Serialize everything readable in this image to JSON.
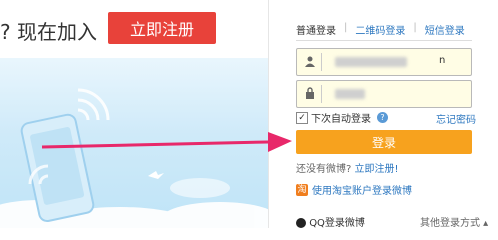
{
  "left": {
    "join_text": "? 现在加入",
    "register_button": "立即注册"
  },
  "tabs": [
    {
      "label": "普通登录"
    },
    {
      "label": "二维码登录"
    },
    {
      "label": "短信登录"
    }
  ],
  "separators": [
    "|",
    "|"
  ],
  "form": {
    "username_trailing": "n",
    "remember_label": "下次自动登录",
    "forgot_label": "忘记密码",
    "login_button": "登录"
  },
  "links": {
    "no_weibo": "还没有微博?",
    "register_now": "立即注册!",
    "taobao_login": "使用淘宝账户登录微博",
    "qq_login": "QQ登录微博",
    "other_methods": "其他登录方式 ▴"
  },
  "colors": {
    "register_red": "#e8423a",
    "login_orange": "#f7a21e",
    "link_blue": "#2e78c0",
    "arrow_pink": "#e8286a"
  },
  "icons": [
    "user-icon",
    "lock-icon",
    "help-icon",
    "taobao-icon",
    "qq-icon",
    "arrow-icon",
    "phone-icon",
    "wifi-icon"
  ]
}
